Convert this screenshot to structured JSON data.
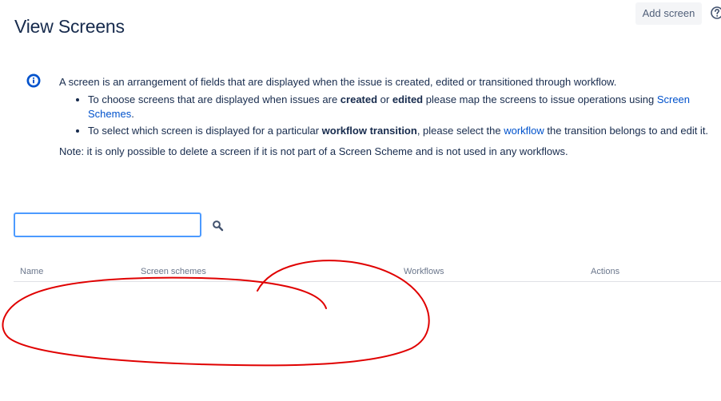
{
  "header": {
    "title": "View Screens",
    "add_screen_label": "Add screen",
    "help_icon": "help-icon"
  },
  "info": {
    "icon": "info-icon",
    "intro": "A screen is an arrangement of fields that are displayed when the issue is created, edited or transitioned through workflow.",
    "bullet1": {
      "t1": "To choose screens that are displayed when issues are ",
      "b1": "created",
      "t2": " or ",
      "b2": "edited",
      "t3": " please map the screens to issue operations using ",
      "link": "Screen Schemes",
      "t4": "."
    },
    "bullet2": {
      "t1": "To select which screen is displayed for a particular ",
      "b1": "workflow transition",
      "t2": ", please select the ",
      "link": "workflow",
      "t3": " the transition belongs to and edit it."
    },
    "note": "Note: it is only possible to delete a screen if it is not part of a Screen Scheme and is not used in any workflows."
  },
  "search": {
    "value": "",
    "placeholder": "",
    "icon": "search-icon"
  },
  "table": {
    "columns": [
      "Name",
      "Screen schemes",
      "Workflows",
      "Actions"
    ]
  },
  "colors": {
    "title": "#172b4d",
    "link": "#0052cc",
    "info_icon": "#0052cc",
    "focus_border": "#4c9aff",
    "annotation": "#e00000"
  }
}
